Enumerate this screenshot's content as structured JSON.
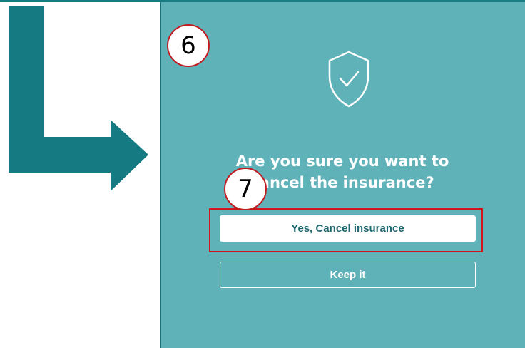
{
  "colors": {
    "panel_background": "#5fb2b8",
    "arrow": "#167a82",
    "primary_button_text": "#1e6870",
    "highlight_border": "#d0141a",
    "badge_border": "#c21c22"
  },
  "arrow": {
    "icon": "turn-right-arrow-icon"
  },
  "dialog": {
    "icon": "shield-check-icon",
    "title_lines": [
      "Are you sure you want to",
      "cancel the insurance?"
    ],
    "confirm_label": "Yes, Cancel insurance",
    "keep_label": "Keep it"
  },
  "annotations": {
    "step_6": "6",
    "step_7": "7"
  }
}
